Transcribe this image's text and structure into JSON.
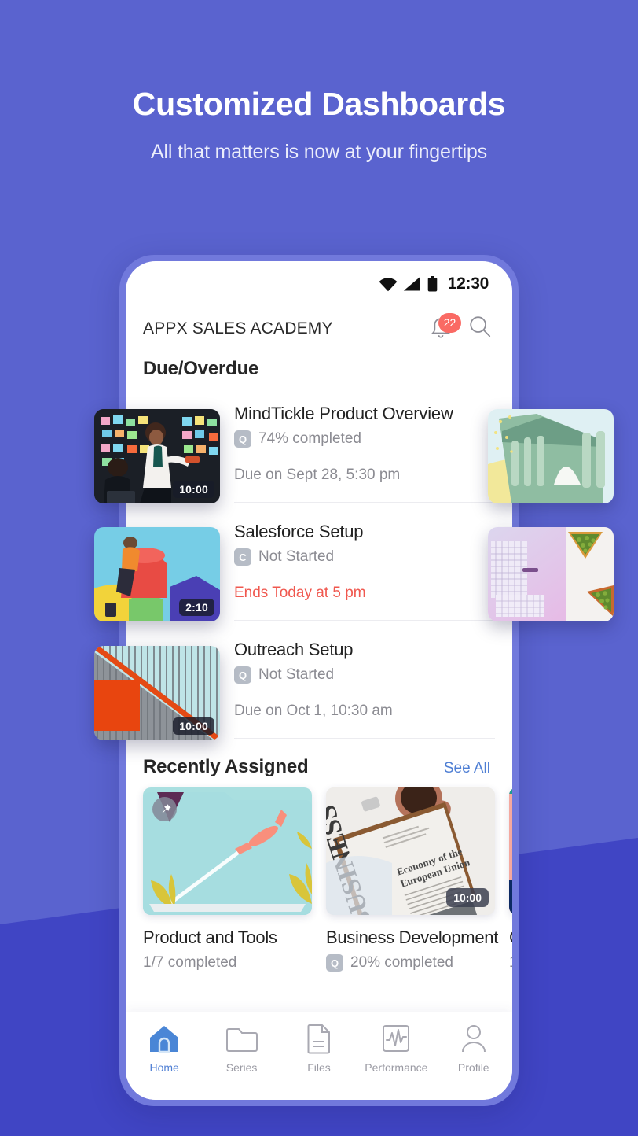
{
  "hero": {
    "title": "Customized Dashboards",
    "subtitle": "All that matters is now at your fingertips"
  },
  "colors": {
    "bg_top": "#5a63cf",
    "bg_bottom": "#4045c4",
    "phone_frame": "#7179dc",
    "accent_link": "#4f7fd4",
    "badge_red": "#fa6a64",
    "urgent_text": "#f0584f"
  },
  "statusbar": {
    "time": "12:30",
    "icons": [
      "wifi-icon",
      "cellular-signal-icon",
      "battery-icon"
    ]
  },
  "header": {
    "title": "APPX SALES ACADEMY",
    "notification_badge": "22",
    "bell_icon": "bell-icon",
    "search_icon": "search-icon"
  },
  "due_section": {
    "title": "Due/Overdue",
    "items": [
      {
        "name": "MindTickle Product Overview",
        "type_chip": "Q",
        "status": "74% completed",
        "when": "Due on Sept 28, 5:30 pm",
        "urgent": false,
        "duration": "10:00"
      },
      {
        "name": "Salesforce Setup",
        "type_chip": "C",
        "status": "Not Started",
        "when": "Ends Today at 5 pm",
        "urgent": true,
        "duration": "2:10"
      },
      {
        "name": "Outreach Setup",
        "type_chip": "Q",
        "status": "Not Started",
        "when": "Due on Oct 1, 10:30 am",
        "urgent": false,
        "duration": "10:00"
      }
    ]
  },
  "recently_assigned": {
    "title": "Recently Assigned",
    "see_all": "See All",
    "cards": [
      {
        "name": "Product and Tools",
        "sub": "1/7 completed",
        "type_chip": "",
        "duration": "",
        "badge_icon": "pin-icon"
      },
      {
        "name": "Business Development",
        "sub": "20% completed",
        "type_chip": "Q",
        "duration": "10:00",
        "badge_icon": ""
      },
      {
        "name": "C",
        "sub": "1",
        "type_chip": "",
        "duration": "",
        "badge_icon": ""
      }
    ]
  },
  "bottom_nav": {
    "items": [
      {
        "label": "Home",
        "icon": "home-icon",
        "active": true
      },
      {
        "label": "Series",
        "icon": "folder-icon",
        "active": false
      },
      {
        "label": "Files",
        "icon": "document-icon",
        "active": false
      },
      {
        "label": "Performance",
        "icon": "chart-pulse-icon",
        "active": false
      },
      {
        "label": "Profile",
        "icon": "person-icon",
        "active": false
      }
    ]
  }
}
